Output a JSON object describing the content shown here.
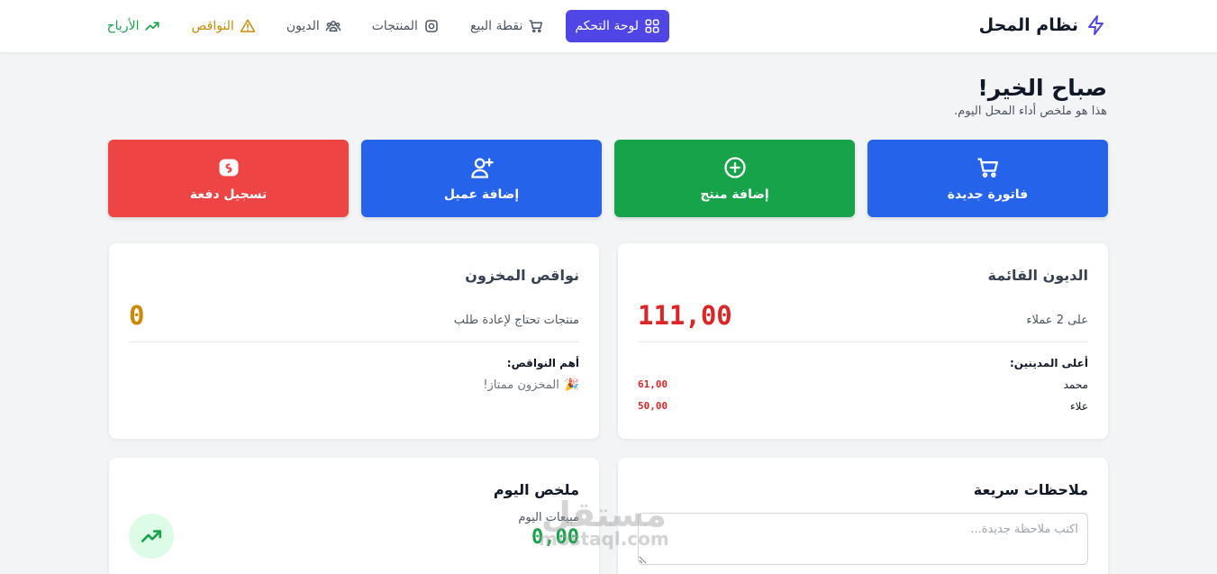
{
  "app": {
    "name": "نظام المحل"
  },
  "nav": {
    "items": [
      {
        "label": "لوحة التحكم",
        "icon": "grid-icon",
        "active": true
      },
      {
        "label": "نقطة البيع",
        "icon": "cart-icon"
      },
      {
        "label": "المنتجات",
        "icon": "box-icon"
      },
      {
        "label": "الديون",
        "icon": "users-icon"
      },
      {
        "label": "النواقص",
        "icon": "warning-icon"
      },
      {
        "label": "الأرباح",
        "icon": "trending-up-icon"
      }
    ]
  },
  "greeting": {
    "title": "صباح الخير!",
    "subtitle": "هذا هو ملخص أداء المحل اليوم."
  },
  "actions": [
    {
      "label": "فاتورة جديدة",
      "icon": "cart-icon",
      "color": "#2563eb"
    },
    {
      "label": "إضافة منتج",
      "icon": "plus-circle-icon",
      "color": "#16a34a"
    },
    {
      "label": "إضافة عميل",
      "icon": "user-plus-icon",
      "color": "#2563eb"
    },
    {
      "label": "تسجيل دفعة",
      "icon": "money-icon",
      "color": "#ef4444"
    }
  ],
  "debts": {
    "title": "الديون القائمة",
    "total": "111,00",
    "customers_text": "على 2 عملاء",
    "top_title": "أعلى المدينين:",
    "debtors": [
      {
        "name": "محمد",
        "amount": "61,00"
      },
      {
        "name": "علاء",
        "amount": "50,00"
      }
    ]
  },
  "stock": {
    "title": "نواقص المخزون",
    "count": "0",
    "count_text": "منتجات تحتاج لإعادة طلب",
    "top_title": "أهم النواقص:",
    "ok_text": "المخزون ممتاز!",
    "ok_emoji": "🎉"
  },
  "notes": {
    "title": "ملاحظات سريعة",
    "placeholder": "اكتب ملاحظة جديدة..."
  },
  "today": {
    "title": "ملخص اليوم",
    "sales_label": "مبيعات اليوم",
    "sales_value": "0,00"
  },
  "watermark": {
    "ar": "مستقل",
    "en": "mostaql.com"
  },
  "colors": {
    "primary": "#4f46e5",
    "blue": "#2563eb",
    "green": "#16a34a",
    "red": "#ef4444",
    "amber": "#ca8a04"
  }
}
